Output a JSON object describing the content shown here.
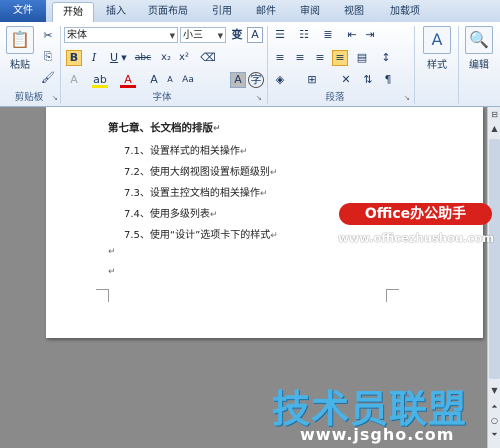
{
  "tabs": [
    "文件",
    "开始",
    "插入",
    "页面布局",
    "引用",
    "邮件",
    "审阅",
    "视图",
    "加载项"
  ],
  "clipboard": {
    "paste_label": "粘贴",
    "group_label": "剪贴板"
  },
  "font": {
    "name": "宋体",
    "size": "小三",
    "group_label": "字体",
    "bold": "B",
    "italic": "I",
    "underline": "U",
    "strike": "abc",
    "subscript": "x₂",
    "superscript": "x²",
    "aa": "Aa",
    "big_a": "A",
    "small_a": "A"
  },
  "paragraph": {
    "group_label": "段落"
  },
  "styles": {
    "label": "样式"
  },
  "editing": {
    "label": "编辑"
  },
  "document": {
    "heading": "第七章、长文档的排版",
    "items": [
      "7.1、设置样式的相关操作",
      "7.2、使用大纲视图设置标题级别",
      "7.3、设置主控文档的相关操作",
      "7.4、使用多级列表",
      "7.5、使用“设计”选项卡下的样式"
    ],
    "paragraph_mark": "↵"
  },
  "watermarks": {
    "badge": "Office办公助手",
    "url": "www.officezhushou.com",
    "site_name": "技术员联盟",
    "site_url": "www.jsgho.com"
  },
  "colors": {
    "file_tab": "#2a5fb0",
    "highlight": "#fbd97a",
    "watermark_red": "#d9211c",
    "watermark_blue": "#49b3e8"
  }
}
